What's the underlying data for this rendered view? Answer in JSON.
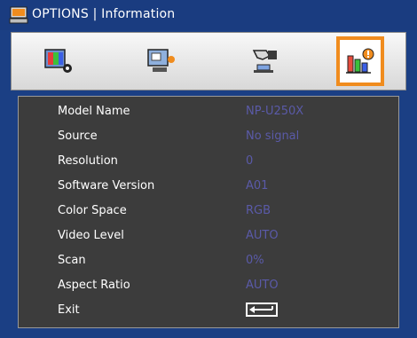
{
  "window": {
    "title": "OPTIONS | Information",
    "title_icon": "options-menu-icon"
  },
  "tabs": [
    {
      "icon": "picture-settings-icon",
      "selected": false
    },
    {
      "icon": "display-settings-icon",
      "selected": false
    },
    {
      "icon": "setup-settings-icon",
      "selected": false
    },
    {
      "icon": "information-settings-icon",
      "selected": true
    }
  ],
  "info_rows": [
    {
      "label": "Model Name",
      "value": "NP-U250X"
    },
    {
      "label": "Source",
      "value": "No signal"
    },
    {
      "label": "Resolution",
      "value": "0"
    },
    {
      "label": "Software Version",
      "value": "A01"
    },
    {
      "label": "Color Space",
      "value": "RGB"
    },
    {
      "label": "Video Level",
      "value": "AUTO"
    },
    {
      "label": "Scan",
      "value": "0%"
    },
    {
      "label": "Aspect Ratio",
      "value": "AUTO"
    }
  ],
  "exit": {
    "label": "Exit",
    "icon": "enter-return-icon"
  },
  "colors": {
    "frame": "#1b3f84",
    "selection": "#f08c1e",
    "panel": "#3c3c3c",
    "value_text": "#5a5aa8"
  }
}
